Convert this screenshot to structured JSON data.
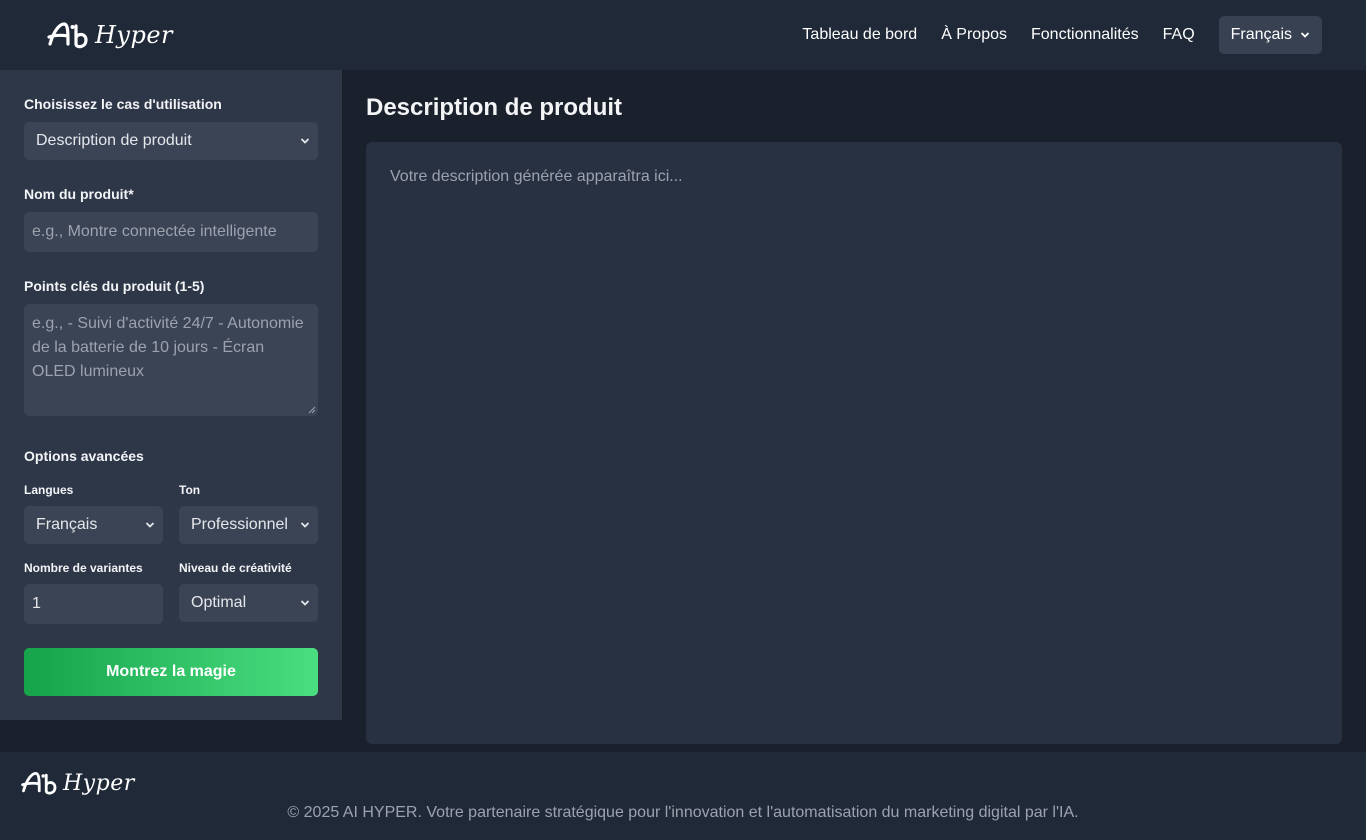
{
  "brand": {
    "logo_mark": "Ai",
    "logo_text": "Hyper"
  },
  "nav": {
    "items": [
      "Tableau de bord",
      "À Propos",
      "Fonctionnalités",
      "FAQ"
    ],
    "language": "Français"
  },
  "sidebar": {
    "use_case_label": "Choisissez le cas d'utilisation",
    "use_case_value": "Description de produit",
    "product_name_label": "Nom du produit*",
    "product_name_placeholder": "e.g., Montre connectée intelligente",
    "key_points_label": "Points clés du produit (1-5)",
    "key_points_placeholder": "e.g., - Suivi d'activité 24/7 - Autonomie de la batterie de 10 jours - Écran OLED lumineux",
    "advanced_label": "Options avancées",
    "languages_label": "Langues",
    "languages_value": "Français",
    "tone_label": "Ton",
    "tone_value": "Professionnel",
    "variants_label": "Nombre de variantes",
    "variants_value": "1",
    "creativity_label": "Niveau de créativité",
    "creativity_value": "Optimal",
    "cta_label": "Montrez la magie"
  },
  "main": {
    "title": "Description de produit",
    "output_placeholder": "Votre description générée apparaîtra ici..."
  },
  "footer": {
    "copyright": "© 2025 AI HYPER. Votre partenaire stratégique pour l'innovation et l'automatisation du marketing digital par l'IA."
  },
  "colors": {
    "header_bg": "#1f2937",
    "sidebar_bg": "#2d3748",
    "input_bg": "#3b4455",
    "accent_start": "#16a34a",
    "accent_end": "#4ade80"
  },
  "icons": [
    "ai-hyper-logo",
    "chevron-down-icon",
    "resize-handle-icon"
  ]
}
